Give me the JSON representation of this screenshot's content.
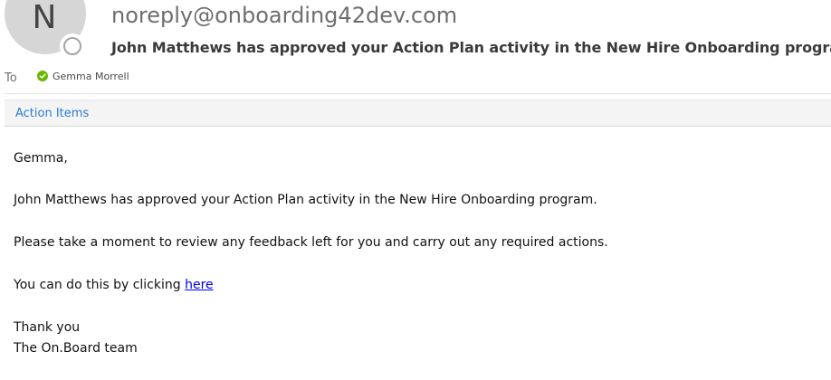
{
  "header": {
    "avatar_letter": "N",
    "sender": "noreply@onboarding42dev.com",
    "subject": "John Matthews has approved your Action Plan activity in the New Hire Onboarding program"
  },
  "recipients": {
    "to_label": "To",
    "items": [
      {
        "name": "Gemma Morrell",
        "status_icon": "check-circle-icon",
        "status_color": "#6bb700"
      }
    ]
  },
  "action_bar": {
    "label": "Action Items"
  },
  "message": {
    "greeting": "Gemma,",
    "line1": "John Matthews has approved your Action Plan activity in the New Hire Onboarding program.",
    "line2": "Please take a moment to review any feedback left for you and carry out any required actions.",
    "line3_prefix": "You can do this by clicking ",
    "line3_link": "here",
    "closing1": "Thank you",
    "closing2": "The On.Board team"
  },
  "colors": {
    "accent_link": "#2b7cd3",
    "hyperlink": "#0000ee",
    "avatar_bg": "#d6d6d6"
  }
}
